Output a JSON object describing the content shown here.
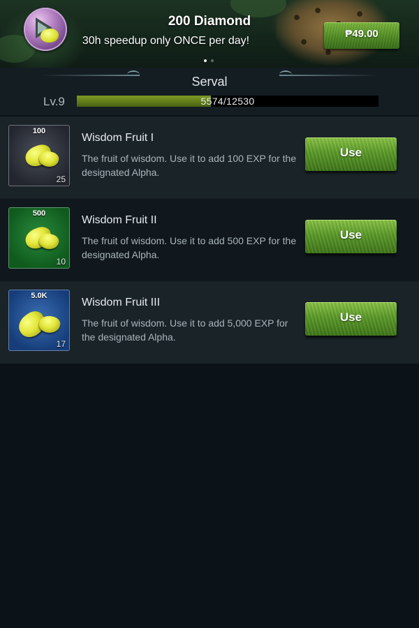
{
  "offer": {
    "title": "200 Diamond",
    "subtitle": "30h speedup only ONCE per day!",
    "price": "₱49.00",
    "carousel_pages": 2,
    "carousel_active": 1
  },
  "animal": {
    "name": "Serval",
    "level": "Lv.9",
    "exp_text": "5574/12530",
    "exp_current": 5574,
    "exp_max": 12530
  },
  "items": [
    {
      "name": "Wisdom Fruit I",
      "description": "The fruit of wisdom. Use it to add 100 EXP for the designated Alpha.",
      "value_badge": "100",
      "count": "25",
      "button_label": "Use",
      "tier_color": "#2f333c",
      "icon": "wisdom-fruit-icon"
    },
    {
      "name": "Wisdom Fruit II",
      "description": "The fruit of wisdom. Use it to add 500 EXP for the designated Alpha.",
      "value_badge": "500",
      "count": "10",
      "button_label": "Use",
      "tier_color": "#1a7a2e",
      "icon": "wisdom-fruit-icon"
    },
    {
      "name": "Wisdom Fruit III",
      "description": "The fruit of wisdom. Use it to add 5,000 EXP for the designated Alpha.",
      "value_badge": "5.0K",
      "count": "17",
      "button_label": "Use",
      "tier_color": "#24549a",
      "icon": "wisdom-fruit-icon"
    }
  ]
}
